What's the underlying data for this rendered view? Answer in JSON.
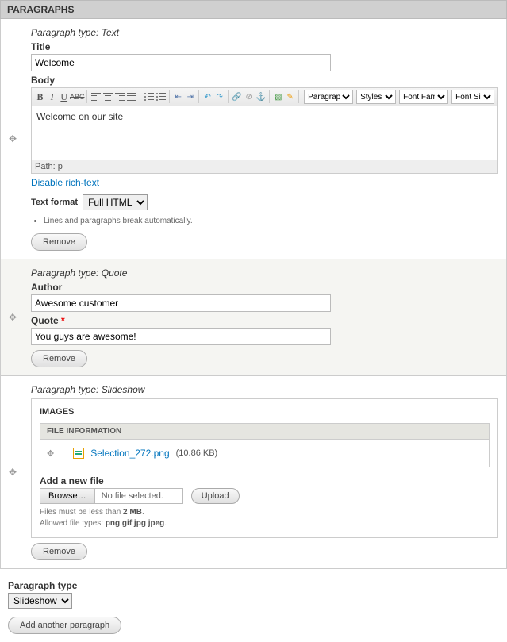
{
  "header": "PARAGRAPHS",
  "para1": {
    "type_label": "Paragraph type:",
    "type_value": "Text",
    "title_label": "Title",
    "title_value": "Welcome",
    "body_label": "Body",
    "toolbar": {
      "format_select": "Paragraph",
      "styles_select": "Styles",
      "font_family_select": "Font Family",
      "font_size_select": "Font Size"
    },
    "body_content": "Welcome on our site",
    "path_label": "Path:",
    "path_value": "p",
    "disable_link": "Disable rich-text",
    "format_label": "Text format",
    "format_value": "Full HTML",
    "hint": "Lines and paragraphs break automatically.",
    "remove": "Remove"
  },
  "para2": {
    "type_label": "Paragraph type:",
    "type_value": "Quote",
    "author_label": "Author",
    "author_value": "Awesome customer",
    "quote_label": "Quote",
    "quote_value": "You guys are awesome!",
    "remove": "Remove"
  },
  "para3": {
    "type_label": "Paragraph type:",
    "type_value": "Slideshow",
    "images_title": "IMAGES",
    "file_info_header": "FILE INFORMATION",
    "file_name": "Selection_272.png",
    "file_size": "(10.86 KB)",
    "add_label": "Add a new file",
    "browse_btn": "Browse…",
    "no_file": "No file selected.",
    "upload": "Upload",
    "hint_size_pre": "Files must be less than ",
    "hint_size_val": "2 MB",
    "hint_types_pre": "Allowed file types: ",
    "hint_types_val": "png gif jpg jpeg",
    "remove": "Remove"
  },
  "bottom": {
    "label": "Paragraph type",
    "select_value": "Slideshow",
    "add_btn": "Add another paragraph"
  }
}
